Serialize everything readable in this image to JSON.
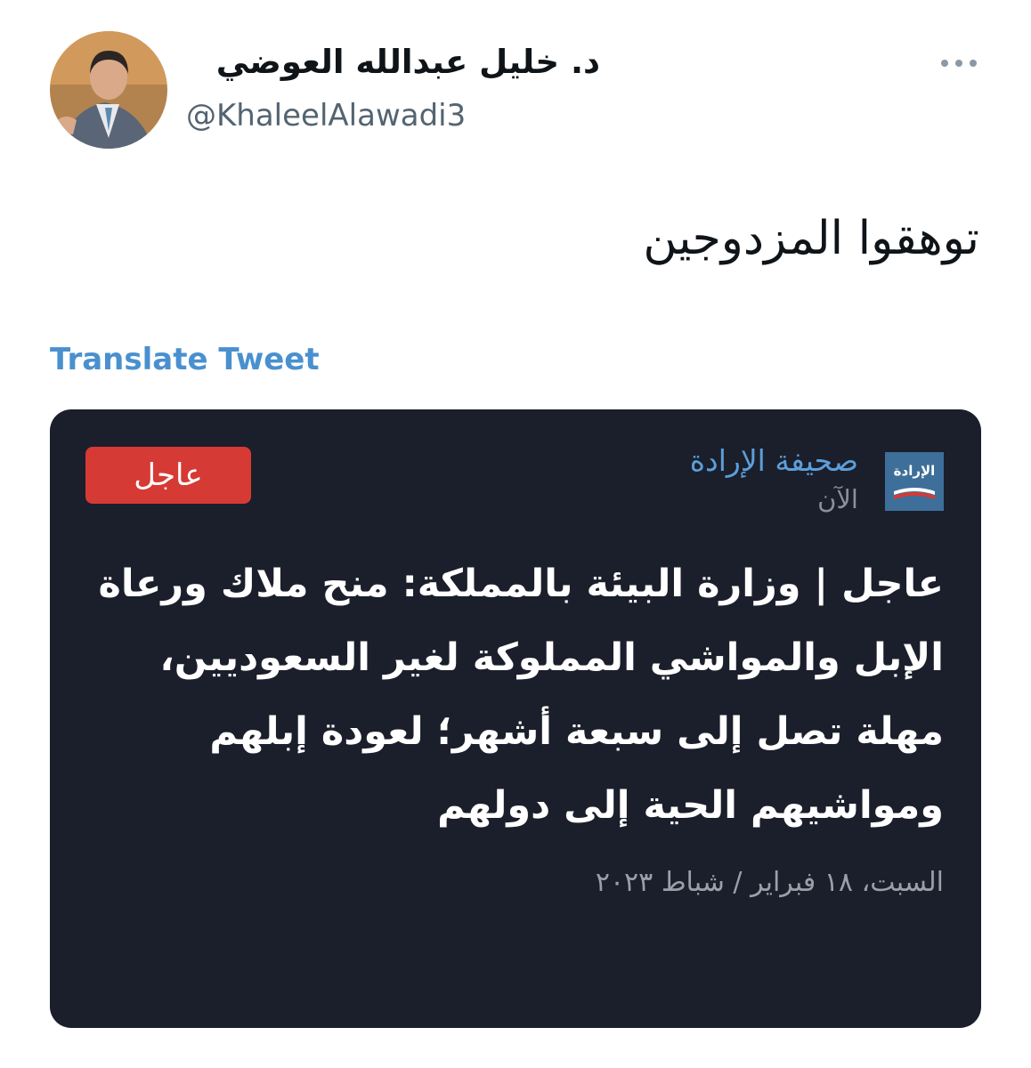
{
  "tweet": {
    "author_name": "د. خليل عبدالله العوضي",
    "author_handle": "@KhaleelAlawadi3",
    "text": "توهقوا المزدوجين",
    "translate_label": "Translate Tweet",
    "more_icon": "more-dots-icon"
  },
  "card": {
    "source_logo_text": "الإرادة",
    "source_name": "صحيفة الإرادة",
    "time": "الآن",
    "badge": "عاجل",
    "headline": "عاجل | وزارة البيئة بالمملكة: منح ملاك ورعاة الإبل والمواشي المملوكة لغير السعوديين، مهلة تصل إلى سبعة أشهر؛ لعودة إبلهم ومواشيهم الحية إلى دولهم",
    "date": "السبت، ١٨ فبراير / شباط ٢٠٢٣"
  },
  "colors": {
    "link": "#4a90cf",
    "card_bg": "#1b1f2b",
    "badge_red": "#d63a34",
    "source_blue": "#5c9fd9"
  }
}
